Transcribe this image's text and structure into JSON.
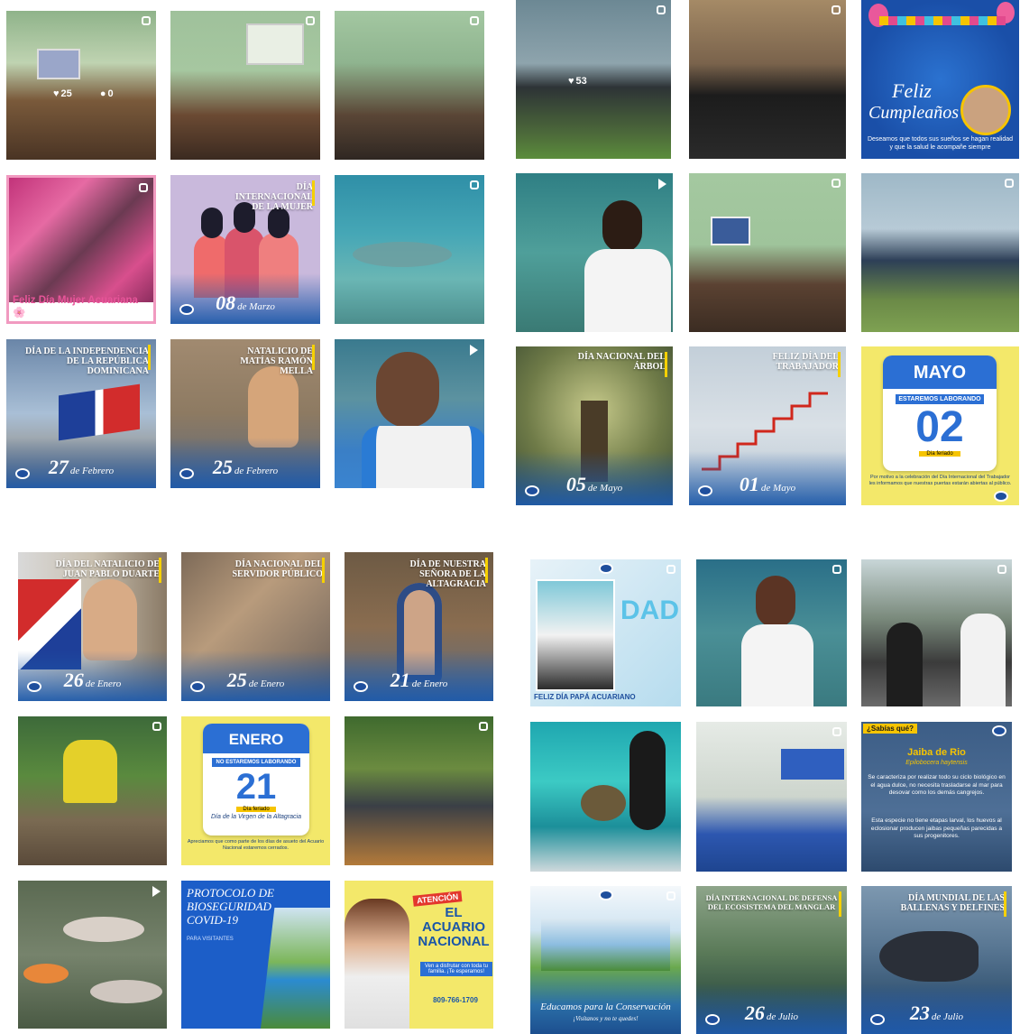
{
  "panel1": {
    "stats": {
      "likes": "25",
      "comments": "0"
    },
    "mujer_caption": "Feliz Día Mujer Acuariana 🌸",
    "dia_mujer": {
      "title": "DÍA INTERNACIONAL DE LA MUJER",
      "day": "08",
      "month": "de Marzo"
    },
    "independencia": {
      "title": "DÍA DE LA INDEPENDENCIA DE LA REPÚBLICA DOMINICANA",
      "day": "27",
      "month": "de Febrero"
    },
    "mella": {
      "title": "NATALICIO DE MATÍAS RAMÓN MELLA",
      "day": "25",
      "month": "de Febrero"
    }
  },
  "panel2": {
    "stats": {
      "likes": "53"
    },
    "birthday": {
      "line1": "Feliz",
      "line2": "Cumpleaños",
      "message": "Deseamos que todos sus sueños se hagan realidad y que la salud le acompañe siempre"
    },
    "arbol": {
      "title": "DÍA NACIONAL DEL ÁRBOL",
      "day": "05",
      "month": "de Mayo"
    },
    "trabajador": {
      "title": "FELIZ DÍA DEL TRABAJADOR",
      "day": "01",
      "month": "de Mayo"
    },
    "mayo": {
      "month": "MAYO",
      "notice": "ESTAREMOS LABORANDO",
      "day": "02",
      "tag": "Día feriado",
      "text": "Por motivo a la celebración del Día Internacional del Trabajador les informamos que nuestras puertas estarán abiertas al público."
    }
  },
  "panel3": {
    "duarte": {
      "title": "DÍA DEL NATALICIO DE JUAN PABLO DUARTE",
      "day": "26",
      "month": "de Enero"
    },
    "servidor": {
      "title": "DÍA NACIONAL DEL SERVIDOR PÚBLICO",
      "day": "25",
      "month": "de Enero"
    },
    "altagracia": {
      "title": "DÍA DE NUESTRA SEÑORA DE LA ALTAGRACIA",
      "day": "21",
      "month": "de Enero"
    },
    "enero": {
      "month": "ENERO",
      "notice": "NO ESTAREMOS LABORANDO",
      "day": "21",
      "tag": "Día feriado",
      "subtitle": "Día de la Virgen de la Altagracia",
      "text": "Apreciamos que como parte de los días de asueto del Acuario Nacional estaremos cerrados."
    },
    "protocolo": {
      "title": "PROTOCOLO DE BIOSEGURIDAD COVID-19",
      "sub": "PARA VISITANTES"
    },
    "atencion": {
      "tag": "ATENCIÓN",
      "title": "EL ACUARIO NACIONAL",
      "body": "Ven a disfrutar con toda tu familia. ¡Te esperamos!",
      "phone": "809-766-1709"
    }
  },
  "panel4": {
    "papa": {
      "caption": "FELIZ DÍA PAPÁ ACUARIANO",
      "word": "DAD"
    },
    "sabias": {
      "tag": "¿Sabías qué?",
      "title": "Jaiba de Rio",
      "latin": "Epilobocera haytensis",
      "p1": "Se caracteriza por realizar todo su ciclo biológico en el agua dulce, no necesita trasladarse al mar para desovar como los demás cangrejos.",
      "p2": "Esta especie no tiene etapas larval, los huevos al eclosionar producen jaibas pequeñas parecidas a sus progenitores."
    },
    "educamos": {
      "line1": "Educamos para la Conservación",
      "line2": "¡Visítanos y no te quedes!"
    },
    "manglar": {
      "title": "DÍA INTERNACIONAL DE DEFENSA DEL ECOSISTEMA DEL MANGLAR",
      "day": "26",
      "month": "de Julio"
    },
    "ballenas": {
      "title": "DÍA MUNDIAL DE LAS BALLENAS Y DELFINES",
      "day": "23",
      "month": "de Julio"
    }
  }
}
